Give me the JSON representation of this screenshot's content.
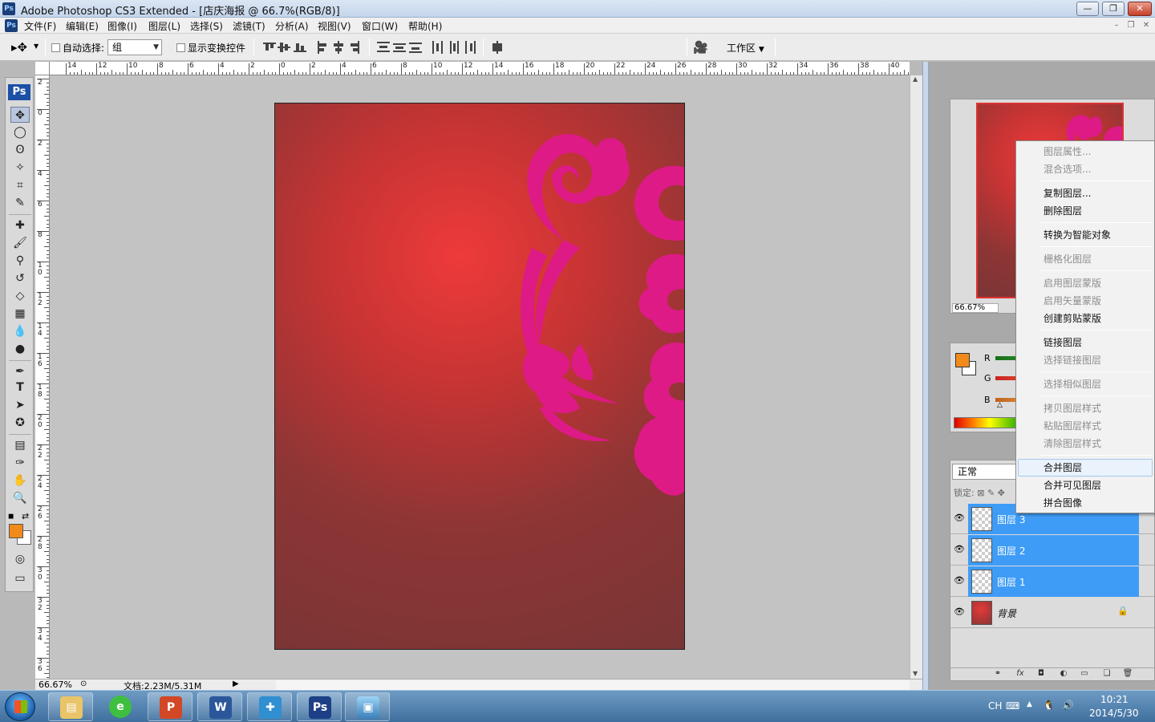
{
  "window": {
    "title": "Adobe Photoshop CS3 Extended - [店庆海报 @ 66.7%(RGB/8)]",
    "app_badge": "Ps"
  },
  "menu": [
    "文件(F)",
    "编辑(E)",
    "图像(I)",
    "图层(L)",
    "选择(S)",
    "滤镜(T)",
    "分析(A)",
    "视图(V)",
    "窗口(W)",
    "帮助(H)"
  ],
  "options": {
    "auto_select_label": "自动选择:",
    "auto_select_value": "组",
    "show_transform_label": "显示变换控件",
    "workspace_label": "工作区"
  },
  "ruler": {
    "top_labels": [
      "14",
      "12",
      "10",
      "8",
      "6",
      "4",
      "2",
      "0",
      "2",
      "4",
      "6",
      "8",
      "10",
      "12",
      "14",
      "16",
      "18",
      "20",
      "22",
      "24",
      "26",
      "28",
      "30",
      "32",
      "34",
      "36",
      "38",
      "40"
    ],
    "left_labels": [
      "2",
      "0",
      "2",
      "4",
      "6",
      "8",
      "10",
      "12",
      "14",
      "16",
      "18",
      "20",
      "22",
      "24",
      "26",
      "28",
      "30",
      "32",
      "34",
      "36"
    ]
  },
  "status": {
    "zoom": "66.67%",
    "doc_info": "文档:2.23M/5.31M"
  },
  "navigator": {
    "zoom": "66.67%"
  },
  "color_panel": {
    "fg_color": "#f28a1a",
    "bg_color": "#ffffff",
    "channels": [
      "R",
      "G",
      "B"
    ]
  },
  "layers": {
    "blend_mode": "正常",
    "lock_label": "锁定:",
    "items": [
      {
        "name": "图层 3",
        "selected": true
      },
      {
        "name": "图层 2",
        "selected": true
      },
      {
        "name": "图层 1",
        "selected": true
      },
      {
        "name": "背景",
        "selected": false,
        "locked": true
      }
    ]
  },
  "context_menu": {
    "groups": [
      [
        {
          "label": "图层属性...",
          "disabled": true
        },
        {
          "label": "混合选项...",
          "disabled": true
        }
      ],
      [
        {
          "label": "复制图层...",
          "disabled": false
        },
        {
          "label": "删除图层",
          "disabled": false
        }
      ],
      [
        {
          "label": "转换为智能对象",
          "disabled": false
        }
      ],
      [
        {
          "label": "栅格化图层",
          "disabled": true
        }
      ],
      [
        {
          "label": "启用图层蒙版",
          "disabled": true
        },
        {
          "label": "启用矢量蒙版",
          "disabled": true
        },
        {
          "label": "创建剪贴蒙版",
          "disabled": false
        }
      ],
      [
        {
          "label": "链接图层",
          "disabled": false
        },
        {
          "label": "选择链接图层",
          "disabled": true
        }
      ],
      [
        {
          "label": "选择相似图层",
          "disabled": true
        }
      ],
      [
        {
          "label": "拷贝图层样式",
          "disabled": true
        },
        {
          "label": "粘贴图层样式",
          "disabled": true
        },
        {
          "label": "清除图层样式",
          "disabled": true
        }
      ],
      [
        {
          "label": "合并图层",
          "disabled": false,
          "hover": true
        },
        {
          "label": "合并可见图层",
          "disabled": false
        },
        {
          "label": "拼合图像",
          "disabled": false
        }
      ]
    ]
  },
  "taskbar": {
    "apps": [
      "explorer-icon",
      "browser-icon",
      "powerpoint-icon",
      "word-icon",
      "toolbox-icon",
      "photoshop-icon",
      "picture-viewer-icon"
    ],
    "ps_label": "Ps",
    "word_label": "W",
    "ime": "CH",
    "time": "10:21",
    "date": "2014/5/30"
  },
  "colors": {
    "accent_selection": "#3e9cf6",
    "flourish": "#de1a86",
    "doc_center": "#ee3a3a",
    "doc_edge": "#793535"
  }
}
